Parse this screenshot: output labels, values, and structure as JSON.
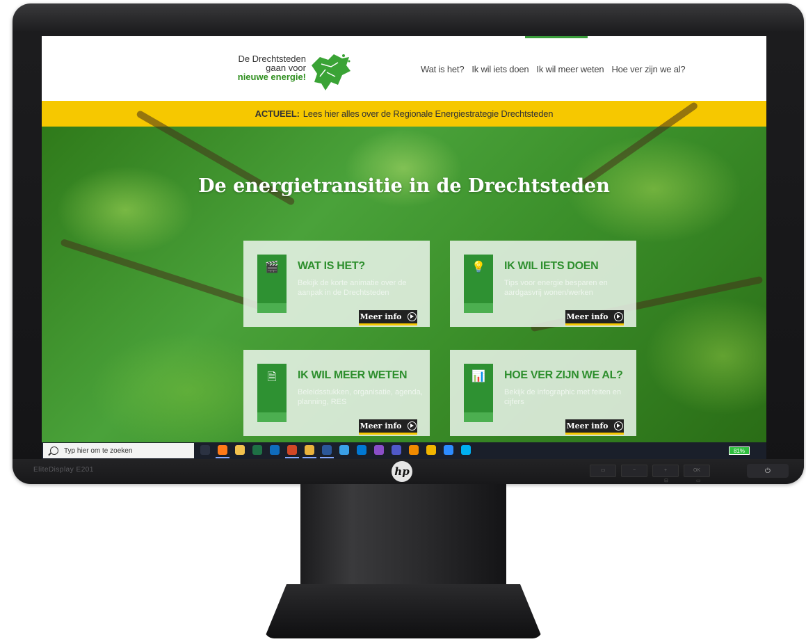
{
  "monitor": {
    "model_label": "EliteDisplay E201",
    "brand": "hp",
    "osd_buttons": [
      "▭",
      "−",
      "+",
      "OK"
    ],
    "osd_sub_labels": [
      "⊟",
      "▭"
    ],
    "power_symbol": "⏻"
  },
  "site": {
    "logo": {
      "line1": "De Drechtsteden",
      "line2": "gaan voor",
      "line3": "nieuwe energie!"
    },
    "nav": [
      {
        "label": "Wat is het?"
      },
      {
        "label": "Ik wil iets doen"
      },
      {
        "label": "Ik wil meer weten"
      },
      {
        "label": "Hoe ver zijn we al?"
      }
    ],
    "news": {
      "prefix": "ACTUEEL:",
      "text": "Lees hier alles over de Regionale Energiestrategie Drechtsteden"
    },
    "hero_title": "De energietransitie in de Drechtsteden",
    "cards": [
      {
        "title": "WAT IS HET?",
        "desc": "Bekijk de korte animatie over de aanpak in de Drechtsteden",
        "button": "Meer info",
        "icon": "clapperboard-icon",
        "glyph": "🎬"
      },
      {
        "title": "IK WIL IETS DOEN",
        "desc": "Tips voor energie besparen en aardgasvrij wonen/werken",
        "button": "Meer info",
        "icon": "lightbulb-icon",
        "glyph": "💡"
      },
      {
        "title": "IK WIL MEER WETEN",
        "desc": "Beleidsstukken, organisatie, agenda, planning, RES",
        "button": "Meer info",
        "icon": "document-icon",
        "glyph": "🗎"
      },
      {
        "title": "HOE VER ZIJN WE AL?",
        "desc": "Bekijk de infographic met feiten en cijfers",
        "button": "Meer info",
        "icon": "chart-screen-icon",
        "glyph": "📊"
      }
    ]
  },
  "taskbar": {
    "search_placeholder": "Typ hier om te zoeken",
    "icons": [
      {
        "name": "task-view-icon",
        "color": "#2b3242"
      },
      {
        "name": "firefox-icon",
        "color": "#ff7a18"
      },
      {
        "name": "file-explorer-icon",
        "color": "#f2c14e"
      },
      {
        "name": "excel-icon",
        "color": "#1e7145"
      },
      {
        "name": "outlook-icon",
        "color": "#0f6cbd"
      },
      {
        "name": "powerpoint-icon",
        "color": "#d24726"
      },
      {
        "name": "chrome-icon",
        "color": "#e9b23c"
      },
      {
        "name": "word-icon",
        "color": "#2b579a"
      },
      {
        "name": "photos-icon",
        "color": "#3aa0e8"
      },
      {
        "name": "store-icon",
        "color": "#0078d4"
      },
      {
        "name": "stream-icon",
        "color": "#8a4ec9"
      },
      {
        "name": "teams-icon",
        "color": "#5059c9"
      },
      {
        "name": "vlc-icon",
        "color": "#f08a00"
      },
      {
        "name": "triangle-app-icon",
        "color": "#f0b400"
      },
      {
        "name": "zoom-icon",
        "color": "#2d8cff"
      },
      {
        "name": "skype-icon",
        "color": "#00aff0"
      }
    ],
    "battery": "81%"
  }
}
